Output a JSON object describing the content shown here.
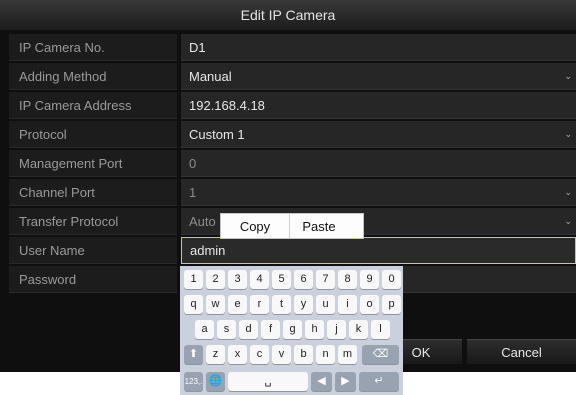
{
  "dialog": {
    "title": "Edit IP Camera"
  },
  "fields": [
    {
      "label": "IP Camera No.",
      "value": "D1",
      "dropdown": false
    },
    {
      "label": "Adding Method",
      "value": "Manual",
      "dropdown": true
    },
    {
      "label": "IP Camera Address",
      "value": "192.168.4.18",
      "dropdown": false
    },
    {
      "label": "Protocol",
      "value": "Custom 1",
      "dropdown": true
    },
    {
      "label": "Management Port",
      "value": "0",
      "dropdown": false
    },
    {
      "label": "Channel Port",
      "value": "1",
      "dropdown": true
    },
    {
      "label": "Transfer Protocol",
      "value": "Auto",
      "dropdown": true
    },
    {
      "label": "User Name",
      "value": "admin",
      "dropdown": false
    },
    {
      "label": "Password",
      "value": "",
      "dropdown": false
    }
  ],
  "context_menu": {
    "copy": "Copy",
    "paste": "Paste"
  },
  "buttons": {
    "ok": "OK",
    "cancel": "Cancel"
  },
  "keyboard": {
    "row1": [
      "1",
      "2",
      "3",
      "4",
      "5",
      "6",
      "7",
      "8",
      "9",
      "0"
    ],
    "row2": [
      "q",
      "w",
      "e",
      "r",
      "t",
      "y",
      "u",
      "i",
      "o",
      "p"
    ],
    "row3": [
      "a",
      "s",
      "d",
      "f",
      "g",
      "h",
      "j",
      "k",
      "l"
    ],
    "row4": [
      "z",
      "x",
      "c",
      "v",
      "b",
      "n",
      "m"
    ],
    "shift_key": "⬆",
    "backspace_key": "⌫",
    "symbols_key": "123,.",
    "globe_key": "🌐",
    "space_key": "␣",
    "left_key": "◀",
    "right_key": "▶",
    "enter_key": "↵"
  },
  "colors": {
    "accent_border": "#c7d93a",
    "dialog_bg": "#0f0f0f"
  }
}
